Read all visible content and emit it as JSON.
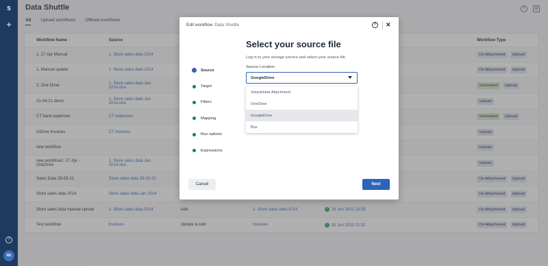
{
  "app": {
    "title": "Data Shuttle",
    "avatar_initials": "RE"
  },
  "rail": {
    "logo": "S",
    "plus_icon": "+",
    "help_icon": "?"
  },
  "header_icons": {
    "help": "?",
    "gift": "⊞"
  },
  "tabs": [
    {
      "label": "All",
      "active": true
    },
    {
      "label": "Upload workflows",
      "active": false
    },
    {
      "label": "Offload workflows",
      "active": false
    }
  ],
  "table": {
    "columns": [
      "Workflow Name",
      "Source",
      "",
      "",
      "",
      "",
      "Workflow Type"
    ],
    "rows": [
      {
        "name": "1. 27 Apr Manual",
        "source": "1. Store sales data 2014",
        "action": "",
        "target": "",
        "date": "",
        "types": [
          "On Attachment",
          "Upload"
        ]
      },
      {
        "name": "1. Manual update",
        "source": "1. Store sales data 2014",
        "action": "",
        "target": "",
        "date": "",
        "types": [
          "On Attachment",
          "Upload"
        ]
      },
      {
        "name": "2. One Drive",
        "source": "1. Store sales data Jan 2014.xlsx",
        "action": "",
        "target": "",
        "date": "",
        "types": [
          "Scheduled",
          "Upload"
        ]
      },
      {
        "name": "21-04-21 demo",
        "source": "1. Store sales data Jan 2014.xlsx",
        "action": "",
        "target": "",
        "date": "",
        "types": [
          "Upload"
        ]
      },
      {
        "name": "CT bank expenses",
        "source": "CT expenses",
        "action": "",
        "target": "",
        "date": "",
        "types": [
          "Scheduled",
          "Upload"
        ]
      },
      {
        "name": "GDrive Invoices",
        "source": "CT invoices",
        "action": "",
        "target": "",
        "date": "",
        "types": [
          "Upload"
        ]
      },
      {
        "name": "new workflow",
        "source": "",
        "action": "",
        "target": "",
        "date": "",
        "types": [
          "Upload"
        ]
      },
      {
        "name": "new workflow2. 27 Apr - OneDrive",
        "source": "1. Store sales data Jan 2014.xlsx",
        "action": "",
        "target": "",
        "date": "",
        "types": [
          "Upload"
        ]
      },
      {
        "name": "Sales Data 29-03-21",
        "source": "Store sales data 29-03-21",
        "action": "",
        "target": "",
        "date": "",
        "types": [
          "On Attachment",
          "Upload"
        ]
      },
      {
        "name": "Store sales data 2014",
        "source": "Store sales data Jan 2014",
        "action": "",
        "target": "",
        "date": "",
        "types": [
          "On Attachment",
          "Upload"
        ]
      },
      {
        "name": "Store sales data manual upload",
        "source": "1. Store sales data 2014",
        "action": "Add",
        "target": "1. Store sales data 2014",
        "date": "16 Jun 2021 13:39",
        "types": [
          "On Attachment",
          "Upload"
        ]
      },
      {
        "name": "Test workflow",
        "source": "Invoices",
        "action": "Update & Add",
        "target": "Invoices",
        "date": "02 Jun 2020 11:33",
        "types": [
          "On Attachment",
          "Upload"
        ]
      }
    ]
  },
  "modal": {
    "header_label": "Edit workflow",
    "header_sub": "Data Shuttle",
    "help_icon": "?",
    "close_icon": "✕",
    "steps": [
      "Source",
      "Target",
      "Filters",
      "Mapping",
      "Run options",
      "Expressions"
    ],
    "active_step": "Source",
    "title": "Select your source file",
    "description": "Log in to your storage service and select your source file.",
    "location_label": "Source Location",
    "selected_location": "GoogleDrive",
    "options": [
      "Smartsheet Attachment",
      "OneDrive",
      "GoogleDrive",
      "Box"
    ],
    "cancel_label": "Cancel",
    "next_label": "Next"
  },
  "colors": {
    "rail": "#1e3a5f",
    "accent": "#2d63b8",
    "step_dot": "#127d80",
    "success": "#22a55b"
  }
}
